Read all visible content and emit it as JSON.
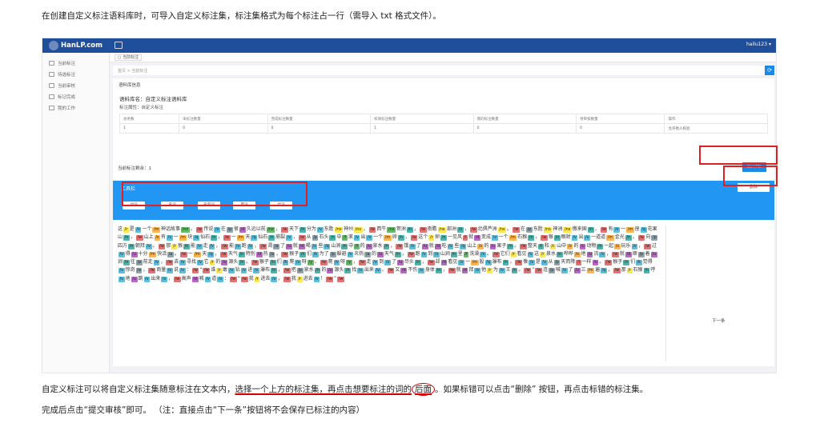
{
  "doc": {
    "intro": "在创建自定义标注语料库时，可导入自定义标注集，标注集格式为每个标注占一行（需导入 txt 格式文件）。",
    "note1_a": "自定义标注可以将自定义标注集随意标注在文本内，",
    "note1_b": "选择一个上方的标注集，再点击想要标注的词",
    "note1_c": "的",
    "note1_d": "后面",
    "note1_e": "。如果标错可以点击“删除” 按钮，再点击标错的标注集。",
    "note2": "完成后点击“提交审核”即可。  （注：直接点击“下一条”按钮将不会保存已标注的内容）"
  },
  "app": {
    "brand": "HanLP.com",
    "user": "hailu123 ▾",
    "sidebar": [
      {
        "icon": "pencil-icon",
        "label": "当前标注"
      },
      {
        "icon": "grid-icon",
        "label": "待选标注"
      },
      {
        "icon": "document-icon",
        "label": "当前审核"
      },
      {
        "icon": "check-icon",
        "label": "标记完成"
      },
      {
        "icon": "user-icon",
        "label": "我的工作"
      }
    ],
    "tab": "○ 当前标注",
    "breadcrumb": "首页  >  当前标注",
    "card_header": "语料库信息",
    "lib_name": "语料库名：自定义标注语料库",
    "lib_attr": "标注属性：自定义标注",
    "stats_headers": [
      "总条数",
      "未标注数量",
      "完成标注数量",
      "校阅标注数量",
      "我的标注数量",
      "待审核数量",
      "操作"
    ],
    "stats_values": [
      "1",
      "0",
      "0",
      "1",
      "0",
      "0",
      "允许他人校验"
    ],
    "done_label": "当前标注剩余：1",
    "submit_label": "提交审核",
    "toolbar_title": "工具栏",
    "delete_label": "删除",
    "tags": [
      "动词",
      "名词",
      "形容词",
      "量词",
      "代词"
    ],
    "next_label": "下一条"
  },
  "text_segments": [
    [
      "这",
      "r"
    ],
    [
      "是",
      "v"
    ],
    [
      "一个",
      "m"
    ],
    [
      "神话故事",
      "nz"
    ],
    [
      "，",
      "w"
    ],
    [
      "传说",
      "v"
    ],
    [
      "在",
      "p"
    ],
    [
      "很",
      "d"
    ],
    [
      "久远以前",
      "nz"
    ],
    [
      "，",
      "w"
    ],
    [
      "天下",
      "n"
    ],
    [
      "分为",
      "v"
    ],
    [
      "东胜",
      "ns"
    ],
    [
      "神州",
      "ns"
    ],
    [
      "，",
      "w"
    ],
    [
      "西牛",
      "nz"
    ],
    [
      "贺洲",
      "n"
    ],
    [
      "，",
      "w"
    ],
    [
      "南瞻",
      "ns"
    ],
    [
      "部洲",
      "n"
    ],
    [
      "，",
      "w"
    ],
    [
      "北俱芦洲",
      "ns"
    ],
    [
      "。",
      "w"
    ],
    [
      "在",
      "p"
    ],
    [
      "东胜",
      "ns"
    ],
    [
      "神洲",
      "ns"
    ],
    [
      "傲来国",
      "n"
    ],
    [
      "，",
      "w"
    ],
    [
      "有",
      "v"
    ],
    [
      "一",
      "m"
    ],
    [
      "座",
      "q"
    ],
    [
      "花果山",
      "n"
    ],
    [
      "，",
      "w"
    ],
    [
      "山上",
      "s"
    ],
    [
      "有",
      "v"
    ],
    [
      "一",
      "m"
    ],
    [
      "块",
      "q"
    ],
    [
      "仙石",
      "n"
    ],
    [
      "，",
      "w"
    ],
    [
      "一",
      "m"
    ],
    [
      "天",
      "q"
    ],
    [
      "仙石",
      "n"
    ],
    [
      "崩裂",
      "v"
    ],
    [
      "，",
      "w"
    ],
    [
      "从",
      "p"
    ],
    [
      "石头",
      "n"
    ],
    [
      "中",
      "f"
    ],
    [
      "滚",
      "v"
    ],
    [
      "出",
      "v"
    ],
    [
      "一个",
      "m"
    ],
    [
      "卵",
      "n"
    ],
    [
      "，",
      "w"
    ],
    [
      "这个",
      "r"
    ],
    [
      "卵",
      "n"
    ],
    [
      "一见风",
      "l"
    ],
    [
      "就",
      "d"
    ],
    [
      "变成",
      "v"
    ],
    [
      "一个",
      "m"
    ],
    [
      "石猴",
      "n"
    ],
    [
      "，",
      "w"
    ],
    [
      "猴",
      "n"
    ],
    [
      "眼射",
      "v"
    ],
    [
      "出",
      "v"
    ],
    [
      "一道道",
      "m"
    ],
    [
      "金光",
      "n"
    ],
    [
      "，",
      "w"
    ],
    [
      "向",
      "p"
    ],
    [
      "四方",
      "n"
    ],
    [
      "朝拜",
      "v"
    ],
    [
      "。",
      "w"
    ],
    [
      "那",
      "r"
    ],
    [
      "猴",
      "n"
    ],
    [
      "能",
      "v"
    ],
    [
      "走",
      "v"
    ],
    [
      "，",
      "w"
    ],
    [
      "能",
      "v"
    ],
    [
      "跑",
      "v"
    ],
    [
      "，",
      "w"
    ],
    [
      "渴",
      "a"
    ],
    [
      "了",
      "u"
    ],
    [
      "就",
      "d"
    ],
    [
      "喝",
      "v"
    ],
    [
      "些",
      "q"
    ],
    [
      "山涧",
      "n"
    ],
    [
      "中",
      "f"
    ],
    [
      "的",
      "u"
    ],
    [
      "泉水",
      "n"
    ],
    [
      "，",
      "w"
    ],
    [
      "饿",
      "v"
    ],
    [
      "了",
      "u"
    ],
    [
      "就",
      "d"
    ],
    [
      "吃",
      "v"
    ],
    [
      "些",
      "q"
    ],
    [
      "山上",
      "s"
    ],
    [
      "的",
      "u"
    ],
    [
      "果子",
      "n"
    ],
    [
      "。",
      "w"
    ],
    [
      "整天",
      "t"
    ],
    [
      "和",
      "c"
    ],
    [
      "山中",
      "s"
    ],
    [
      "的",
      "u"
    ],
    [
      "动物",
      "n"
    ],
    [
      "一起",
      "s"
    ],
    [
      "玩乐",
      "v"
    ],
    [
      "，",
      "w"
    ],
    [
      "过",
      "v"
    ],
    [
      "得",
      "u"
    ],
    [
      "十分",
      "m"
    ],
    [
      "快活",
      "a"
    ],
    [
      "。",
      "w"
    ],
    [
      "一",
      "m"
    ],
    [
      "天",
      "q"
    ],
    [
      "，",
      "w"
    ],
    [
      "天气",
      "n"
    ],
    [
      "特别",
      "d"
    ],
    [
      "热",
      "a"
    ],
    [
      "，",
      "w"
    ],
    [
      "猴子",
      "n"
    ],
    [
      "们",
      "k"
    ],
    [
      "为了",
      "p"
    ],
    [
      "躲避",
      "v"
    ],
    [
      "炎热",
      "a"
    ],
    [
      "的",
      "u"
    ],
    [
      "天气",
      "n"
    ],
    [
      "，",
      "w"
    ],
    [
      "跑",
      "v"
    ],
    [
      "到",
      "v"
    ],
    [
      "山涧",
      "n"
    ],
    [
      "里",
      "f"
    ],
    [
      "洗澡",
      "v"
    ],
    [
      "。",
      "w"
    ],
    [
      "它们",
      "r"
    ],
    [
      "看见",
      "v"
    ],
    [
      "这",
      "r"
    ],
    [
      "泉水",
      "n"
    ],
    [
      "哗哗",
      "o"
    ],
    [
      "地",
      "u"
    ],
    [
      "流",
      "v"
    ],
    [
      "，",
      "w"
    ],
    [
      "就",
      "d"
    ],
    [
      "顺",
      "p"
    ],
    [
      "着",
      "u"
    ],
    [
      "涧",
      "n"
    ],
    [
      "往",
      "p"
    ],
    [
      "前走",
      "v"
    ],
    [
      "，",
      "w"
    ],
    [
      "去",
      "v"
    ],
    [
      "寻找",
      "v"
    ],
    [
      "它",
      "r"
    ],
    [
      "的",
      "u"
    ],
    [
      "源头",
      "n"
    ],
    [
      "。",
      "w"
    ],
    [
      "猴子",
      "n"
    ],
    [
      "们",
      "k"
    ],
    [
      "爬",
      "v"
    ],
    [
      "呀",
      "y"
    ],
    [
      "、",
      "w"
    ],
    [
      "爬",
      "v"
    ],
    [
      "呀",
      "y"
    ],
    [
      "，",
      "w"
    ],
    [
      "走",
      "v"
    ],
    [
      "到",
      "v"
    ],
    [
      "了",
      "u"
    ],
    [
      "尽头",
      "n"
    ],
    [
      "，",
      "w"
    ],
    [
      "却",
      "d"
    ],
    [
      "看见",
      "v"
    ],
    [
      "一",
      "m"
    ],
    [
      "股",
      "q"
    ],
    [
      "瀑布",
      "n"
    ],
    [
      "，",
      "w"
    ],
    [
      "像",
      "v"
    ],
    [
      "是",
      "v"
    ],
    [
      "从",
      "p"
    ],
    [
      "天而降",
      "l"
    ],
    [
      "一样",
      "u"
    ],
    [
      "。",
      "w"
    ],
    [
      "猴子",
      "n"
    ],
    [
      "们",
      "k"
    ],
    [
      "觉得",
      "v"
    ],
    [
      "惊奇",
      "a"
    ],
    [
      "，",
      "w"
    ],
    [
      "商量",
      "v"
    ],
    [
      "说",
      "v"
    ],
    [
      "：",
      "w"
    ],
    [
      "“",
      "w"
    ],
    [
      "谁",
      "r"
    ],
    [
      "敢",
      "v"
    ],
    [
      "钻",
      "v"
    ],
    [
      "进",
      "v"
    ],
    [
      "瀑布",
      "n"
    ],
    [
      "，",
      "w"
    ],
    [
      "把",
      "p"
    ],
    [
      "泉水",
      "n"
    ],
    [
      "的",
      "u"
    ],
    [
      "源头",
      "n"
    ],
    [
      "找",
      "v"
    ],
    [
      "出来",
      "v"
    ],
    [
      "，",
      "w"
    ],
    [
      "又",
      "d"
    ],
    [
      "不伤",
      "v"
    ],
    [
      "身体",
      "n"
    ],
    [
      "，",
      "w"
    ],
    [
      "就",
      "d"
    ],
    [
      "拜",
      "v"
    ],
    [
      "他",
      "r"
    ],
    [
      "为",
      "v"
    ],
    [
      "王",
      "n"
    ],
    [
      "。",
      "w"
    ],
    [
      "”",
      "w"
    ],
    [
      "连",
      "p"
    ],
    [
      "喊",
      "v"
    ],
    [
      "了",
      "u"
    ],
    [
      "三",
      "m"
    ],
    [
      "遍",
      "q"
    ],
    [
      "，",
      "w"
    ],
    [
      "那",
      "r"
    ],
    [
      "石猴",
      "n"
    ],
    [
      "呼",
      "v"
    ],
    [
      "地",
      "u"
    ],
    [
      "跳",
      "v"
    ],
    [
      "出来",
      "v"
    ],
    [
      "，",
      "w"
    ],
    [
      "高声",
      "d"
    ],
    [
      "喊",
      "v"
    ],
    [
      "道",
      "v"
    ],
    [
      "：",
      "w"
    ],
    [
      "“",
      "w"
    ],
    [
      "我",
      "r"
    ],
    [
      "进去",
      "v"
    ],
    [
      "，",
      "w"
    ],
    [
      "我",
      "r"
    ],
    [
      "进去",
      "v"
    ],
    [
      "！",
      "w"
    ],
    [
      "”",
      "w"
    ]
  ],
  "tag_colors": [
    "#fde84f",
    "#5bc0de",
    "#ffb74d",
    "#66bb6a",
    "#e57373",
    "#90a4ae",
    "#ba68c8",
    "#4db6ac"
  ]
}
